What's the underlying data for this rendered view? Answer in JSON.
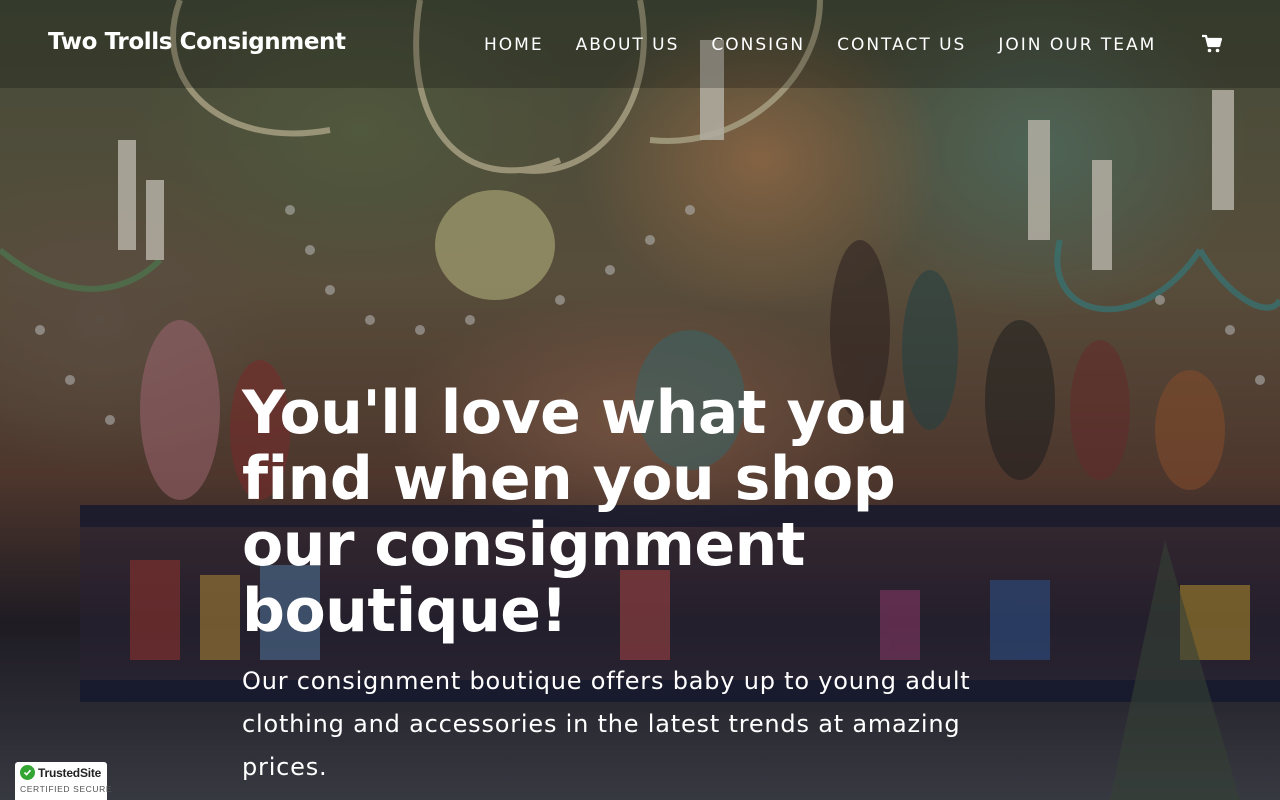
{
  "header": {
    "brand": "Two Trolls Consignment",
    "nav": [
      {
        "label": "HOME"
      },
      {
        "label": "ABOUT US"
      },
      {
        "label": "CONSIGN"
      },
      {
        "label": "CONTACT US"
      },
      {
        "label": "JOIN OUR TEAM"
      }
    ],
    "cart_icon": "shopping-cart-icon"
  },
  "hero": {
    "title": "You'll love what you find when you shop our consignment boutique!",
    "subtitle": "Our consignment boutique offers baby up to young adult clothing and accessories in the latest trends at amazing prices."
  },
  "badge": {
    "name": "TrustedSite",
    "tagline": "CERTIFIED SECURE",
    "accent": "#33a532"
  },
  "colors": {
    "text": "#ffffff",
    "header_overlay": "rgba(0,0,0,0.22)"
  }
}
